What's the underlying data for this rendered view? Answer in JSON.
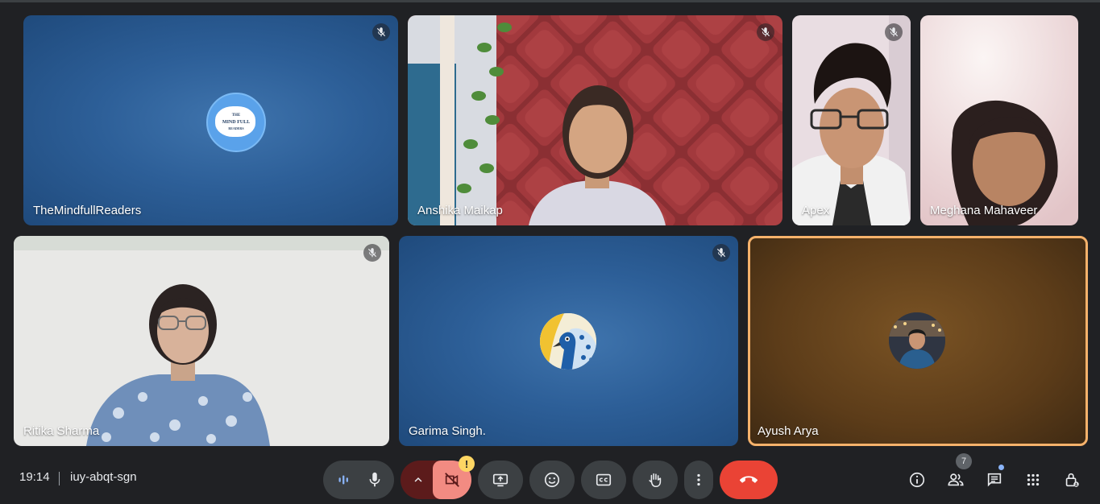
{
  "participants": [
    {
      "name": "TheMindfullReaders",
      "avatar_text": [
        "THE",
        "MIND FULL",
        "READERS"
      ],
      "muted": true
    },
    {
      "name": "Anshika Maikap",
      "muted": true
    },
    {
      "name": "Apex",
      "muted": true
    },
    {
      "name": "Meghana Mahaveer",
      "muted": false
    },
    {
      "name": "Ritika Sharma",
      "muted": true
    },
    {
      "name": "Garima Singh.",
      "muted": true
    },
    {
      "name": "Ayush Arya",
      "muted": false,
      "speaking": true
    }
  ],
  "meeting": {
    "time": "19:14",
    "code": "iuy-abqt-sgn",
    "people_count": "7",
    "camera_warning": "!"
  },
  "colors": {
    "page_bg": "#202124",
    "pill_bg": "#3c4043",
    "end_call": "#ea4335",
    "camera_off": "#f28b82",
    "speaking_border": "#f6b26b",
    "warning": "#fdd663"
  },
  "icons": [
    "mic-off-icon",
    "mic-icon",
    "audio-level-icon",
    "chevron-up-icon",
    "camera-off-icon",
    "present-icon",
    "emoji-icon",
    "captions-icon",
    "raise-hand-icon",
    "more-vert-icon",
    "end-call-icon",
    "info-icon",
    "people-icon",
    "chat-icon",
    "activities-icon",
    "host-controls-icon"
  ]
}
